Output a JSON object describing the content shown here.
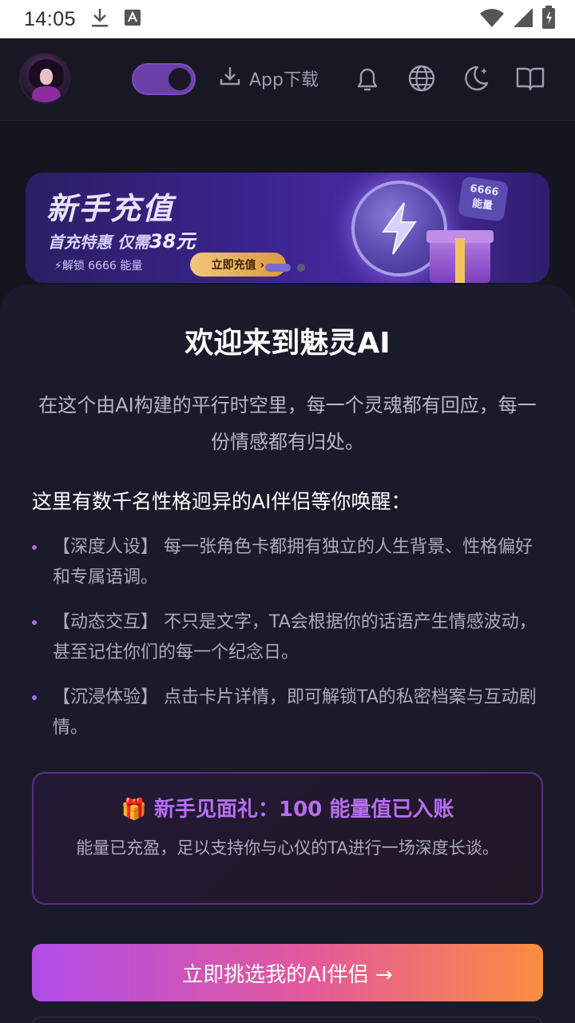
{
  "status_bar": {
    "time": "14:05",
    "icons": [
      "download-icon",
      "font-icon",
      "wifi-icon",
      "signal-icon",
      "battery-icon"
    ]
  },
  "header": {
    "avatar": "avatar-image",
    "toggle_state": "on",
    "app_download_label": "App下载",
    "icons": [
      "bell-icon",
      "globe-icon",
      "moon-icon",
      "book-icon"
    ]
  },
  "banner": {
    "title": "新手充值",
    "subtitle_prefix": "首充特惠 仅需",
    "subtitle_amount": "38元",
    "unlock_text": "⚡解锁 6666 能量",
    "button_label": "立即充值 ›",
    "tag_line1": "6666",
    "tag_line2": "能量",
    "active_slide": 1,
    "slide_count": 2
  },
  "modal": {
    "title": "欢迎来到魅灵AI",
    "intro": "在这个由AI构建的平行时空里，每一个灵魂都有回应，每一份情感都有归处。",
    "subheading": "这里有数千名性格迥异的AI伴侣等你唤醒：",
    "features": [
      "【深度人设】 每一张角色卡都拥有独立的人生背景、性格偏好和专属语调。",
      "【动态交互】 不只是文字，TA会根据你的话语产生情感波动，甚至记住你们的每一个纪念日。",
      "【沉浸体验】 点击卡片详情，即可解锁TA的私密档案与互动剧情。"
    ],
    "gift": {
      "title": "🎁 新手见面礼：100 能量值已入账",
      "text": "能量已充盈，足以支持你与心仪的TA进行一场深度长谈。"
    },
    "cta_label": "立即挑选我的AI伴侣 →"
  },
  "colors": {
    "background": "#14151f",
    "sheet": "#1a1b2a",
    "accent_purple": "#b66df2",
    "cta_start": "#b04de8",
    "cta_end": "#fb8d3f"
  }
}
